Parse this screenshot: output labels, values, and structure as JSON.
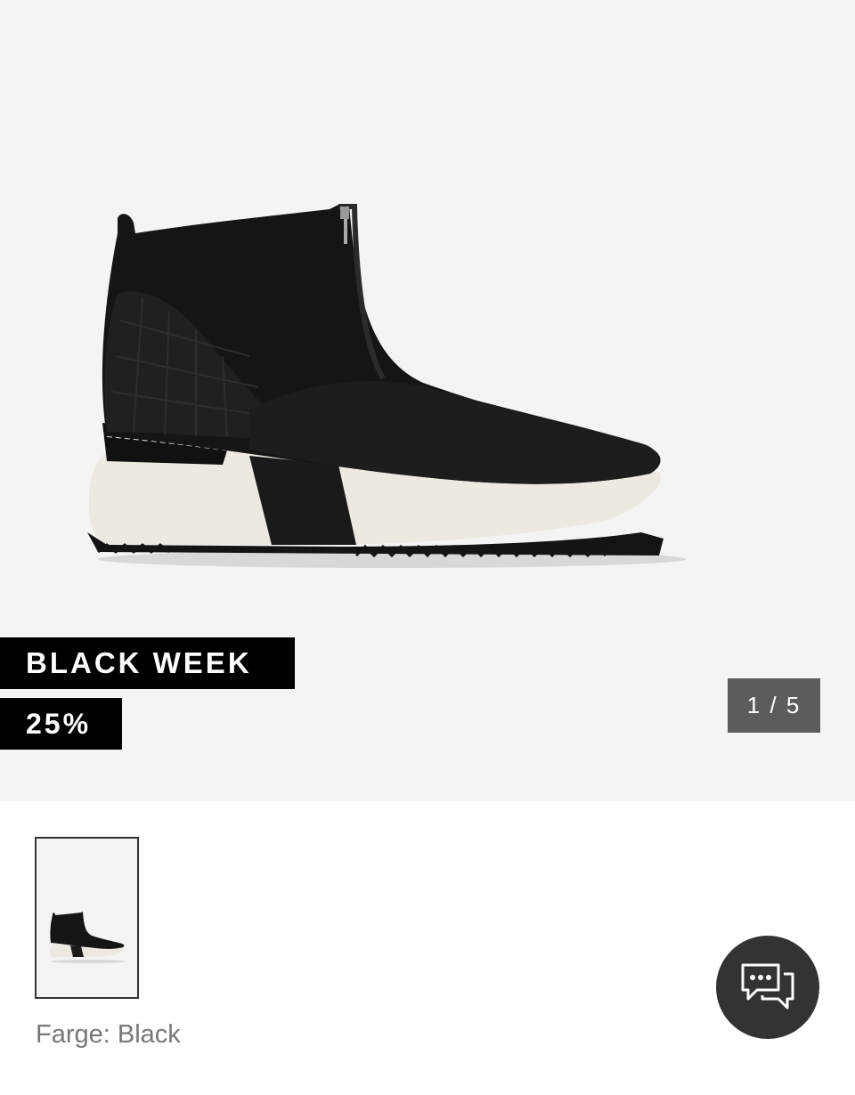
{
  "gallery": {
    "image_alt": "Black sneaker boot with front zip and white sole",
    "badges": {
      "campaign": "BLACK WEEK",
      "discount": "25%"
    },
    "counter": {
      "current": "1",
      "separator": " / ",
      "total": "5"
    }
  },
  "thumbnails": [
    {
      "alt": "Black sneaker boot thumbnail",
      "selected": true
    }
  ],
  "product": {
    "color_label": "Farge: Black"
  },
  "chat": {
    "icon": "chat-bubbles-icon"
  },
  "colors": {
    "hero_bg": "#f4f4f4",
    "badge_bg": "#000000",
    "counter_bg": "#5c5c5c",
    "chat_bg": "#333333",
    "color_label_text": "#777777"
  }
}
